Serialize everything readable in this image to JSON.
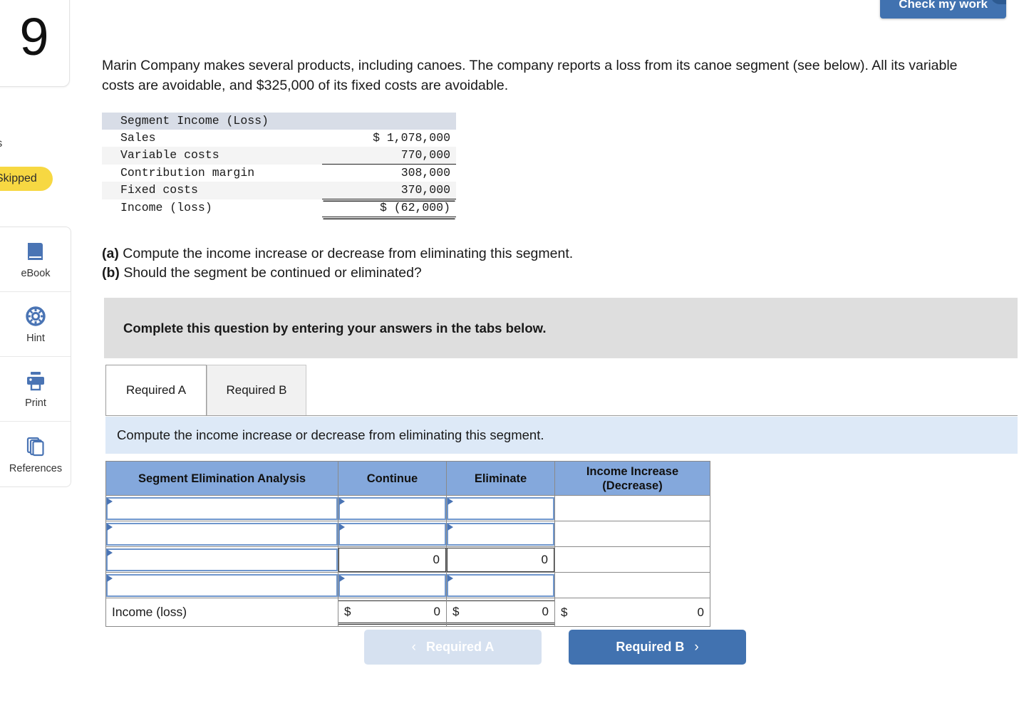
{
  "question_number": "9",
  "rail": {
    "points_label": "ints",
    "status_badge": "Skipped",
    "tools": [
      {
        "icon": "ebook-icon",
        "label": "eBook"
      },
      {
        "icon": "hint-lifering-icon",
        "label": "Hint"
      },
      {
        "icon": "printer-icon",
        "label": "Print"
      },
      {
        "icon": "references-copy-icon",
        "label": "References"
      }
    ]
  },
  "header": {
    "check_my_work_label": "Check my work"
  },
  "prompt": "Marin Company makes several products, including canoes. The company reports a loss from its canoe segment (see below). All its variable costs are avoidable, and $325,000 of its fixed costs are avoidable.",
  "segment_statement": {
    "title": "Segment Income (Loss)",
    "rows": [
      {
        "label": "Sales",
        "amount": "$ 1,078,000",
        "rule": "none"
      },
      {
        "label": "Variable costs",
        "amount": "770,000",
        "rule": "single"
      },
      {
        "label": "Contribution margin",
        "amount": "308,000",
        "rule": "none"
      },
      {
        "label": "Fixed costs",
        "amount": "370,000",
        "rule": "double"
      },
      {
        "label": "Income (loss)",
        "amount": "$ (62,000)",
        "rule": "double"
      }
    ]
  },
  "requirements": {
    "a_tag": "(a)",
    "a_text": "Compute the income increase or decrease from eliminating this segment.",
    "b_tag": "(b)",
    "b_text": "Should the segment be continued or eliminated?"
  },
  "instruction_band": "Complete this question by entering your answers in the tabs below.",
  "tabs": [
    {
      "label": "Required A",
      "active": true
    },
    {
      "label": "Required B",
      "active": false
    }
  ],
  "requirement_band": "Compute the income increase or decrease from eliminating this segment.",
  "answer_table": {
    "headers": [
      "Segment Elimination Analysis",
      "Continue",
      "Eliminate",
      "Income Increase\n(Decrease)"
    ],
    "header_line1": "Income Increase",
    "header_line2": "(Decrease)",
    "rows": [
      {
        "desc": "",
        "desc_type": "select",
        "continue": "",
        "continue_type": "select",
        "eliminate": "",
        "eliminate_type": "select",
        "income": "",
        "income_type": "blank"
      },
      {
        "desc": "",
        "desc_type": "select",
        "continue": "",
        "continue_type": "select",
        "eliminate": "",
        "eliminate_type": "select",
        "income": "",
        "income_type": "blank"
      },
      {
        "desc": "",
        "desc_type": "select",
        "continue": "0",
        "continue_type": "value",
        "eliminate": "0",
        "eliminate_type": "value",
        "income": "",
        "income_type": "blank"
      },
      {
        "desc": "",
        "desc_type": "select",
        "continue": "",
        "continue_type": "select",
        "eliminate": "",
        "eliminate_type": "select",
        "income": "",
        "income_type": "blank"
      }
    ],
    "total_row": {
      "label": "Income (loss)",
      "continue_symbol": "$",
      "continue_value": "0",
      "eliminate_symbol": "$",
      "eliminate_value": "0",
      "income_symbol": "$",
      "income_value": "0"
    }
  },
  "nav": {
    "prev_label": "Required A",
    "prev_chevron": "‹",
    "next_label": "Required B",
    "next_chevron": "›"
  },
  "colors": {
    "accent_blue": "#4172b0",
    "table_header_blue": "#84a8dc",
    "band_blue": "#dde9f7",
    "band_grey": "#dedede",
    "skipped_yellow": "#f7d842",
    "cell_border_blue": "#6f96cc"
  }
}
